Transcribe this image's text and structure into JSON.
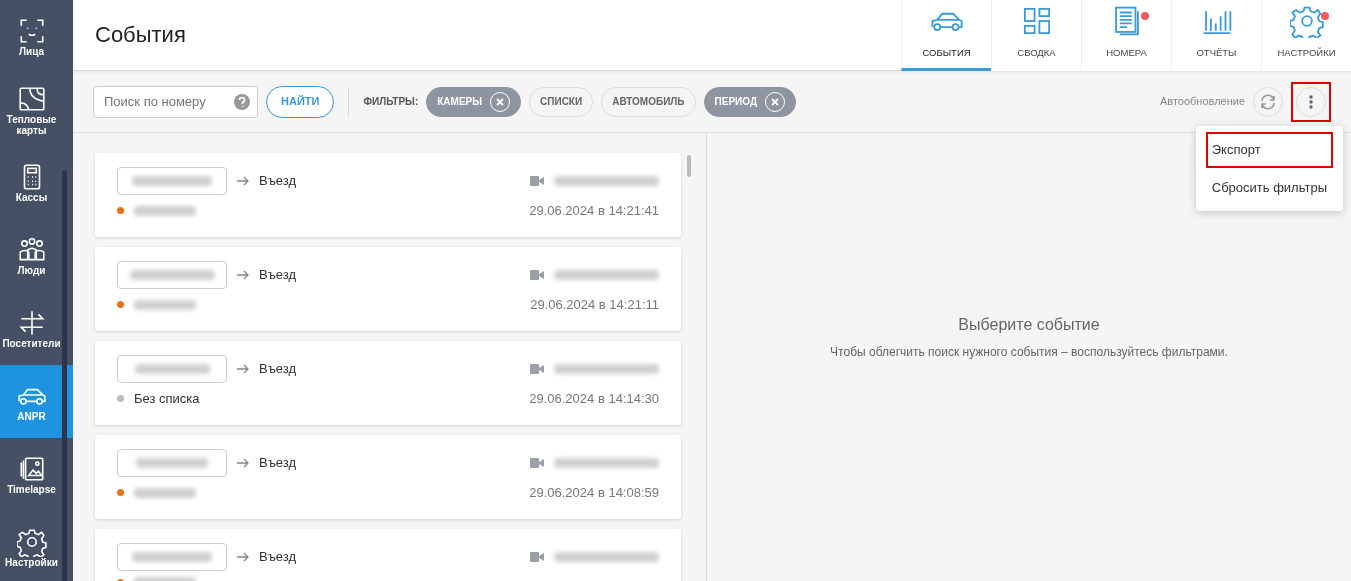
{
  "sidebar": {
    "items": [
      {
        "label": "Лица",
        "selected": false
      },
      {
        "label": "Тепловые карты",
        "selected": false
      },
      {
        "label": "Кассы",
        "selected": false
      },
      {
        "label": "Люди",
        "selected": false
      },
      {
        "label": "Посетители",
        "selected": false
      },
      {
        "label": "ANPR",
        "selected": true
      },
      {
        "label": "Timelapse",
        "selected": false
      },
      {
        "label": "Настройки",
        "selected": false
      }
    ]
  },
  "header": {
    "title": "События",
    "tabs": [
      {
        "label": "СОБЫТИЯ",
        "selected": true,
        "notification": false
      },
      {
        "label": "СВОДКА",
        "selected": false,
        "notification": false
      },
      {
        "label": "НОМЕРА",
        "selected": false,
        "notification": true
      },
      {
        "label": "ОТЧЁТЫ",
        "selected": false,
        "notification": false
      },
      {
        "label": "НАСТРОЙКИ",
        "selected": false,
        "notification": true
      }
    ]
  },
  "toolbar": {
    "search": {
      "placeholder": "Поиск по номеру"
    },
    "find_button": "НАЙТИ",
    "filters_label": "ФИЛЬТРЫ:",
    "filters": [
      {
        "label": "КАМЕРЫ",
        "active": true
      },
      {
        "label": "СПИСКИ",
        "active": false
      },
      {
        "label": "АВТОМОБИЛЬ",
        "active": false
      },
      {
        "label": "ПЕРИОД",
        "active": true
      }
    ],
    "autoupdate_label": "Автообновление",
    "menu_button": {
      "highlighted": true
    },
    "menu": {
      "items": [
        {
          "label": "Экспорт",
          "highlighted": true
        },
        {
          "label": "Сбросить фильтры",
          "highlighted": false
        }
      ]
    }
  },
  "events": [
    {
      "direction": "Въезд",
      "color": "#e8711c",
      "date": "29.06.2024 в 14:21:41"
    },
    {
      "direction": "Въезд",
      "color": "#e8711c",
      "date": "29.06.2024 в 14:21:11"
    },
    {
      "direction": "Въезд",
      "color": "#bdbdbd",
      "list_label": "Без списка",
      "date": "29.06.2024 в 14:14:30"
    },
    {
      "direction": "Въезд",
      "color": "#e8711c",
      "date": "29.06.2024 в 14:08:59"
    },
    {
      "direction": "Въезд",
      "color": "#e8711c"
    }
  ],
  "detail": {
    "title": "Выберите событие",
    "hint": "Чтобы облегчить поиск нужного события – воспользуйтесь фильтрами."
  }
}
